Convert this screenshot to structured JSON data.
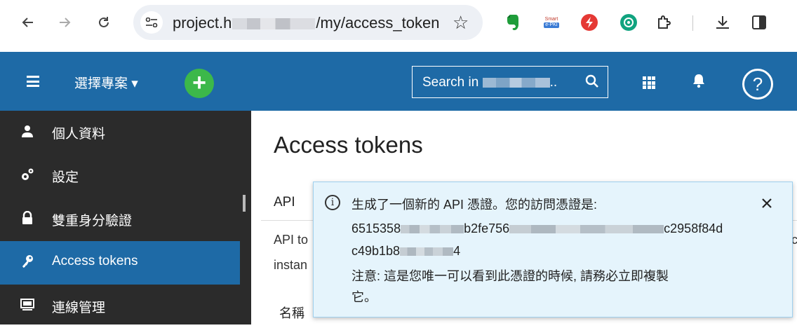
{
  "browser": {
    "url_prefix": "project.h",
    "url_suffix": "/my/access_token",
    "ext_label_top": "Smart",
    "ext_label_bottom": "e-PKI"
  },
  "header": {
    "project_select_label": "選擇專案",
    "search_prefix": "Search in",
    "search_suffix": ".."
  },
  "sidebar": {
    "items": [
      {
        "label": "個人資料",
        "icon": "user-icon"
      },
      {
        "label": "設定",
        "icon": "gears-icon"
      },
      {
        "label": "雙重身分驗證",
        "icon": "lock-icon"
      },
      {
        "label": "Access tokens",
        "icon": "key-icon",
        "active": true
      },
      {
        "label": "連線管理",
        "icon": "monitor-icon"
      }
    ]
  },
  "main": {
    "title": "Access tokens",
    "tab_api": "API",
    "desc_line1": "API to",
    "desc_line2": "instan",
    "column_name": "名稱",
    "right_fragment": "c"
  },
  "notice": {
    "line1": "生成了一個新的 API 憑證。您的訪問憑證是:",
    "token_part1": "6515358",
    "token_part2": "b2fe756",
    "token_part3": "c2958f84d",
    "token_line2_part1": "c49b1b8",
    "token_line2_part2": "4",
    "warning_line1": "注意: 這是您唯一可以看到此憑證的時候, 請務必立即複製",
    "warning_line2": "它。"
  },
  "colors": {
    "appbar": "#1e6aa6",
    "sidebar": "#2b2b2b",
    "active_item": "#1e6aa6",
    "add_button": "#3cb84a",
    "notice_bg": "#e5f4fc",
    "notice_border": "#9fd0ee"
  }
}
